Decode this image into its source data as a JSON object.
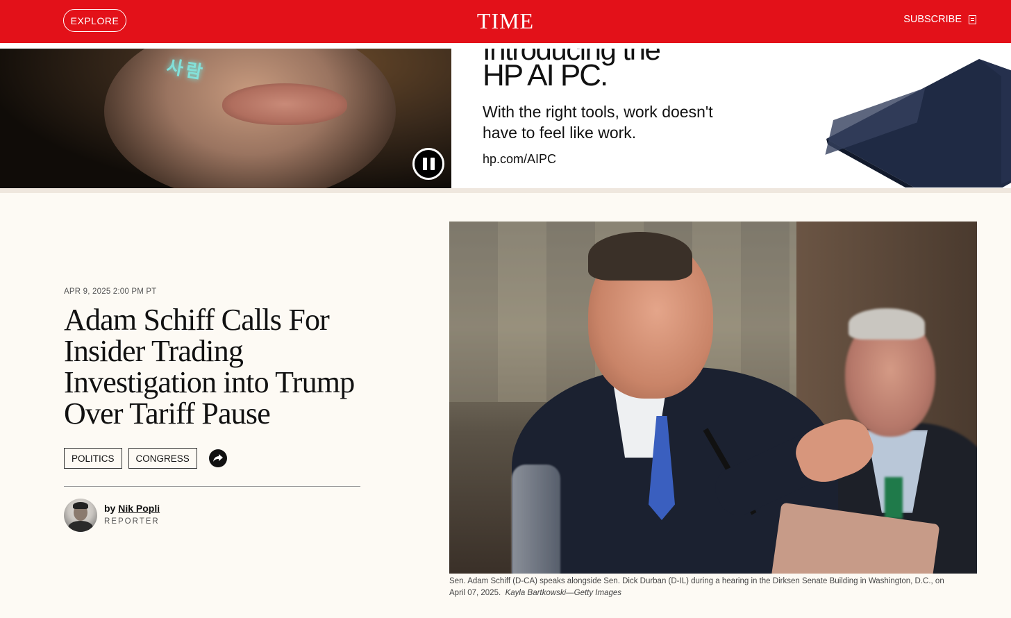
{
  "header": {
    "explore_label": "EXPLORE",
    "logo": "TIME",
    "subscribe_label": "SUBSCRIBE",
    "brand_color": "#e31119"
  },
  "ad": {
    "headline_cut": "Introducing the",
    "headline": "HP AI PC.",
    "body": "With the right tools, work doesn't have to feel like work.",
    "url": "hp.com/AIPC",
    "overlay_text": "사람"
  },
  "article": {
    "date": "APR 9, 2025 2:00 PM PT",
    "headline": "Adam Schiff Calls For Insider Trading Investigation into Trump Over Tariff Pause",
    "tags": [
      "POLITICS",
      "CONGRESS"
    ],
    "byline_prefix": "by",
    "author": "Nik Popli",
    "author_role": "REPORTER",
    "caption": "Sen. Adam Schiff (D-CA) speaks alongside Sen. Dick Durban (D-IL) during a hearing in the Dirksen Senate Building in Washington, D.C., on April 07, 2025.",
    "credit": "Kayla Bartkowski—Getty Images"
  }
}
